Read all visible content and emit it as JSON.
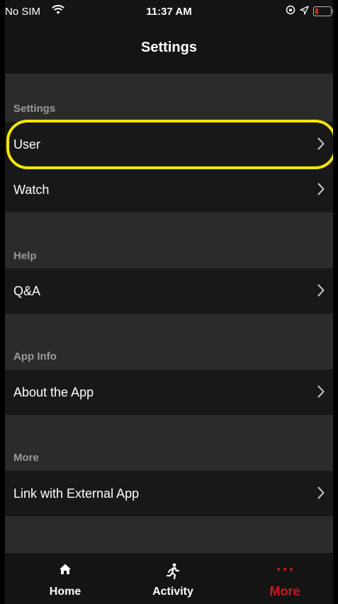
{
  "status_bar": {
    "carrier": "No SIM",
    "time": "11:37 AM"
  },
  "header": {
    "title": "Settings"
  },
  "sections": [
    {
      "header": "Settings",
      "items": [
        {
          "label": "User"
        },
        {
          "label": "Watch"
        }
      ]
    },
    {
      "header": "Help",
      "items": [
        {
          "label": "Q&A"
        }
      ]
    },
    {
      "header": "App Info",
      "items": [
        {
          "label": "About the App"
        }
      ]
    },
    {
      "header": "More",
      "items": [
        {
          "label": "Link with External App"
        }
      ]
    }
  ],
  "tab_bar": {
    "tabs": [
      {
        "label": "Home",
        "icon": "home-icon"
      },
      {
        "label": "Activity",
        "icon": "running-person-icon"
      },
      {
        "label": "More",
        "icon": "ellipsis-icon",
        "active": true
      }
    ]
  },
  "colors": {
    "accent": "#d1141b",
    "highlight_ring": "#f4e600",
    "row_background": "#181818",
    "page_background": "#2b2b2b"
  }
}
